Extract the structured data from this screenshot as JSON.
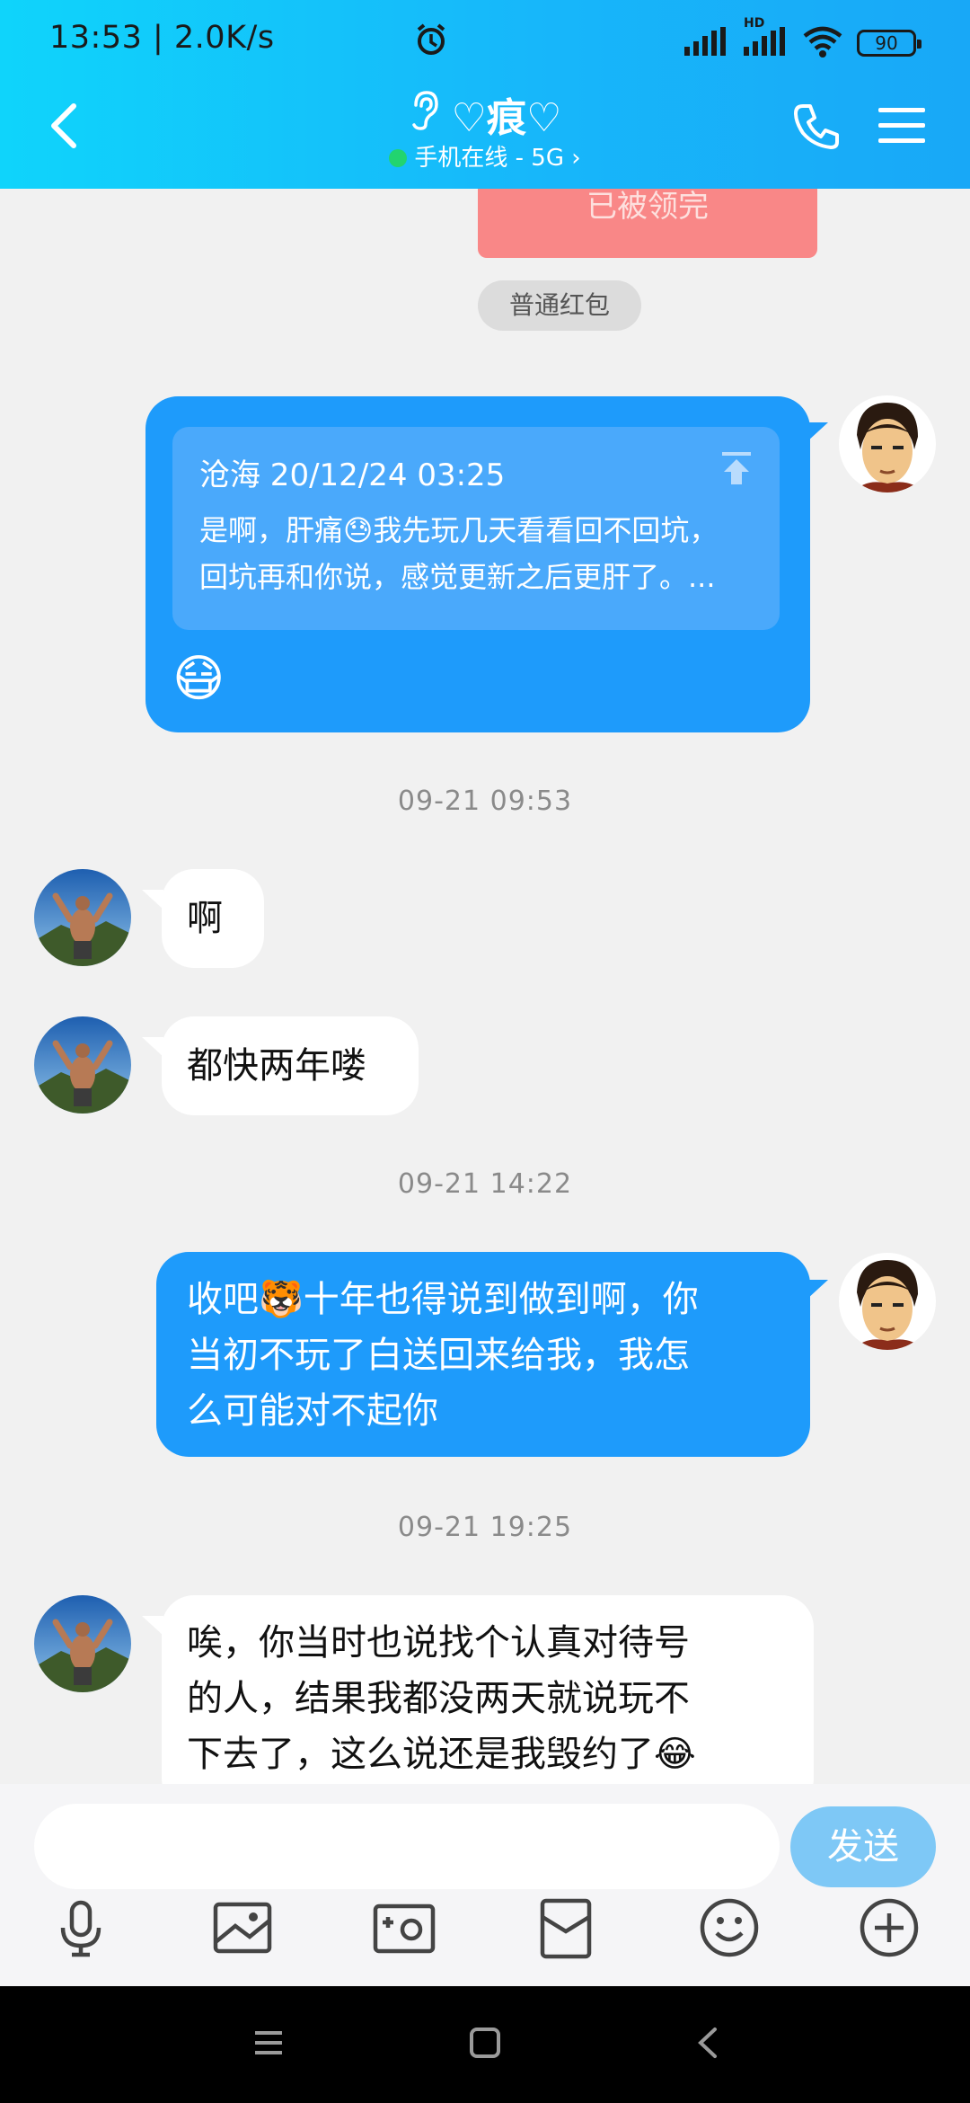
{
  "status_bar": {
    "time_speed": "13:53 | 2.0K/s",
    "battery": "90",
    "network_label": "HD"
  },
  "header": {
    "title": "♡痕♡",
    "subtitle": "手机在线 - 5G",
    "subtitle_chevron": "›",
    "icons": [
      "back-arrow-icon",
      "ear-icon",
      "phone-icon",
      "menu-icon"
    ]
  },
  "chat": {
    "red_packet": {
      "status": "已被领完",
      "type_label": "普通红包"
    },
    "messages": [
      {
        "side": "out",
        "quote": {
          "author_time": "沧海 20/12/24 03:25",
          "text_line1": "是啊，肝痛😓我先玩几天看看回不回坑，",
          "text_line2": "回坑再和你说，感觉更新之后更肝了。..."
        },
        "sticker": "😷"
      },
      {
        "side": "time",
        "text": "09-21 09:53"
      },
      {
        "side": "in",
        "text": "啊"
      },
      {
        "side": "in",
        "text": "都快两年喽"
      },
      {
        "side": "time",
        "text": "09-21 14:22"
      },
      {
        "side": "out",
        "text_line1": "收吧🐯十年也得说到做到啊，你",
        "text_line2": "当初不玩了白送回来给我，我怎",
        "text_line3": "么可能对不起你"
      },
      {
        "side": "time",
        "text": "09-21 19:25"
      },
      {
        "side": "in",
        "text_line1": "唉，你当时也说找个认真对待号",
        "text_line2": "的人，结果我都没两天就说玩不",
        "text_line3": "下去了，这么说还是我毁约了😂"
      }
    ]
  },
  "input_bar": {
    "placeholder": "",
    "send_label": "发送",
    "tools": [
      "microphone-icon",
      "image-icon",
      "camera-icon",
      "red-packet-icon",
      "emoji-icon",
      "plus-icon"
    ]
  },
  "colors": {
    "header_start": "#0fd4fb",
    "header_end": "#18a8f7",
    "bubble_out": "#1e9bfb",
    "send_button": "#7ec8f6",
    "red_packet": "#f98787"
  }
}
